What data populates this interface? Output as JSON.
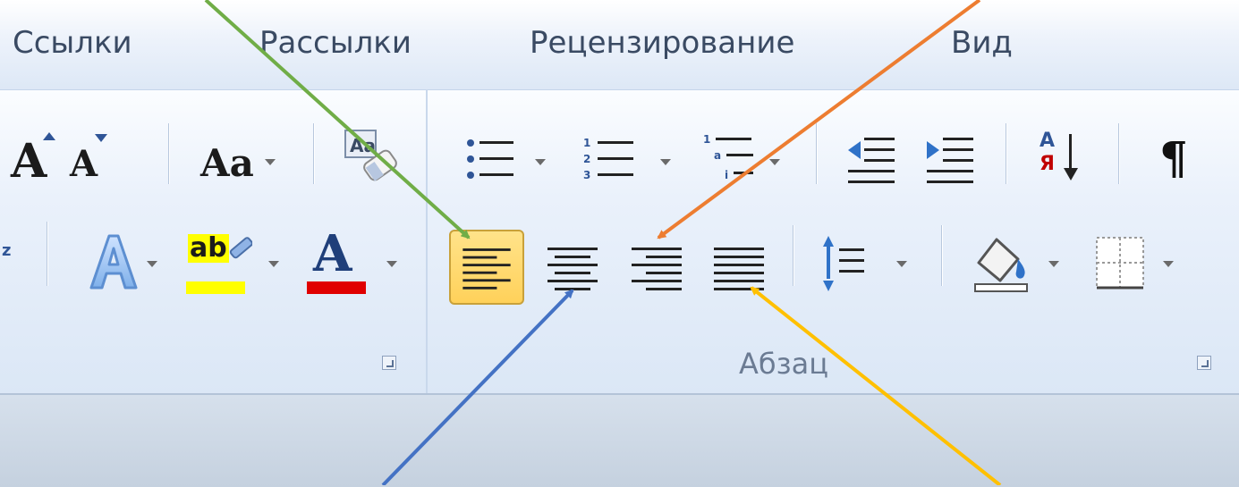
{
  "tabs": [
    "Ссылки",
    "Рассылки",
    "Рецензирование",
    "Вид"
  ],
  "groups": {
    "paragraph_label": "Абзац"
  },
  "font_group": {
    "grow_font": "A",
    "shrink_font": "A",
    "change_case": "Aa",
    "highlight_label": "ab",
    "font_color_letter": "A",
    "highlight_color": "#ffff00",
    "font_color": "#e00000"
  },
  "paragraph_group": {
    "sort_letters": "А Я",
    "pilcrow": "¶",
    "active_alignment": "align-left"
  },
  "annotation_arrow_colors": {
    "green": "#70ad47",
    "orange": "#ed7d31",
    "blue": "#4472c4",
    "yellow": "#ffc000"
  }
}
